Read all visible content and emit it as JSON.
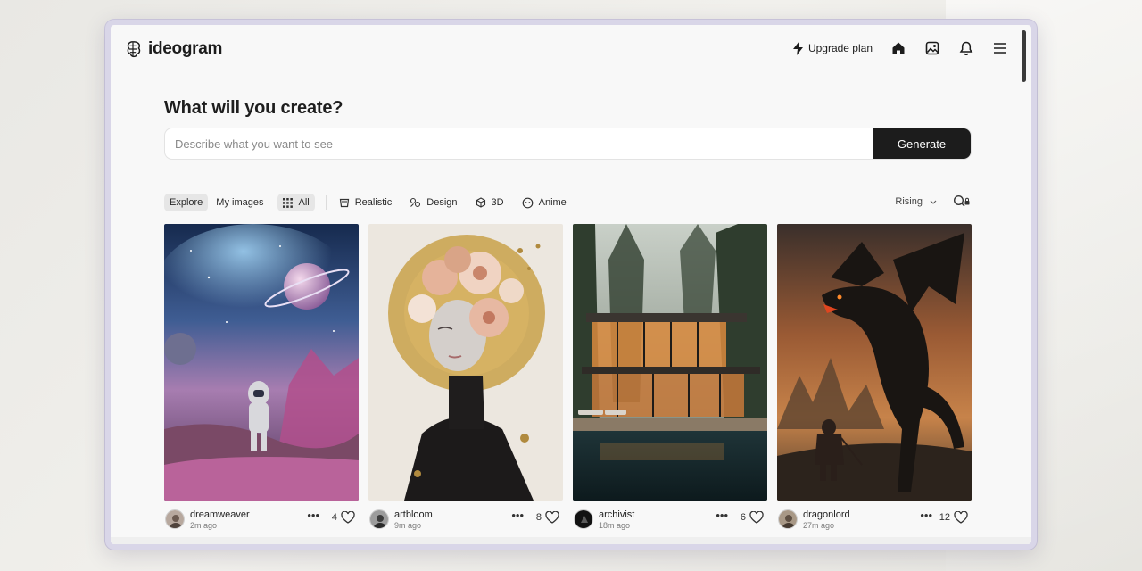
{
  "app": {
    "name": "ideogram"
  },
  "topnav": {
    "upgrade_label": "Upgrade plan",
    "icons": [
      "bolt-icon",
      "home-icon",
      "gallery-icon",
      "bell-icon",
      "menu-icon"
    ]
  },
  "create": {
    "headline": "What will you create?",
    "placeholder": "Describe what you want to see",
    "value": "",
    "generate_label": "Generate"
  },
  "filters": {
    "tabs": [
      {
        "label": "Explore",
        "active": true
      },
      {
        "label": "My images",
        "active": false
      }
    ],
    "categories": [
      {
        "label": "All",
        "icon": "grid-icon",
        "active": true
      },
      {
        "label": "Realistic",
        "icon": "camera-icon",
        "active": false
      },
      {
        "label": "Design",
        "icon": "palette-icon",
        "active": false
      },
      {
        "label": "3D",
        "icon": "cube-icon",
        "active": false
      },
      {
        "label": "Anime",
        "icon": "face-icon",
        "active": false
      }
    ],
    "sort_label": "Rising"
  },
  "gallery": [
    {
      "username": "dreamweaver",
      "time": "2m ago",
      "likes": "4",
      "subject": "astronaut on alien planet with ringed planet and nebula"
    },
    {
      "username": "artbloom",
      "time": "9m ago",
      "likes": "8",
      "subject": "woman with flower crown and gold halo"
    },
    {
      "username": "archivist",
      "time": "18m ago",
      "likes": "6",
      "subject": "modern glass house in forest with pool"
    },
    {
      "username": "dragonlord",
      "time": "27m ago",
      "likes": "12",
      "subject": "dragon and warrior in fiery landscape"
    }
  ],
  "colors": {
    "accent": "#1c1c1c",
    "window_border": "#d9d6e8",
    "background": "#f8f8f8"
  }
}
